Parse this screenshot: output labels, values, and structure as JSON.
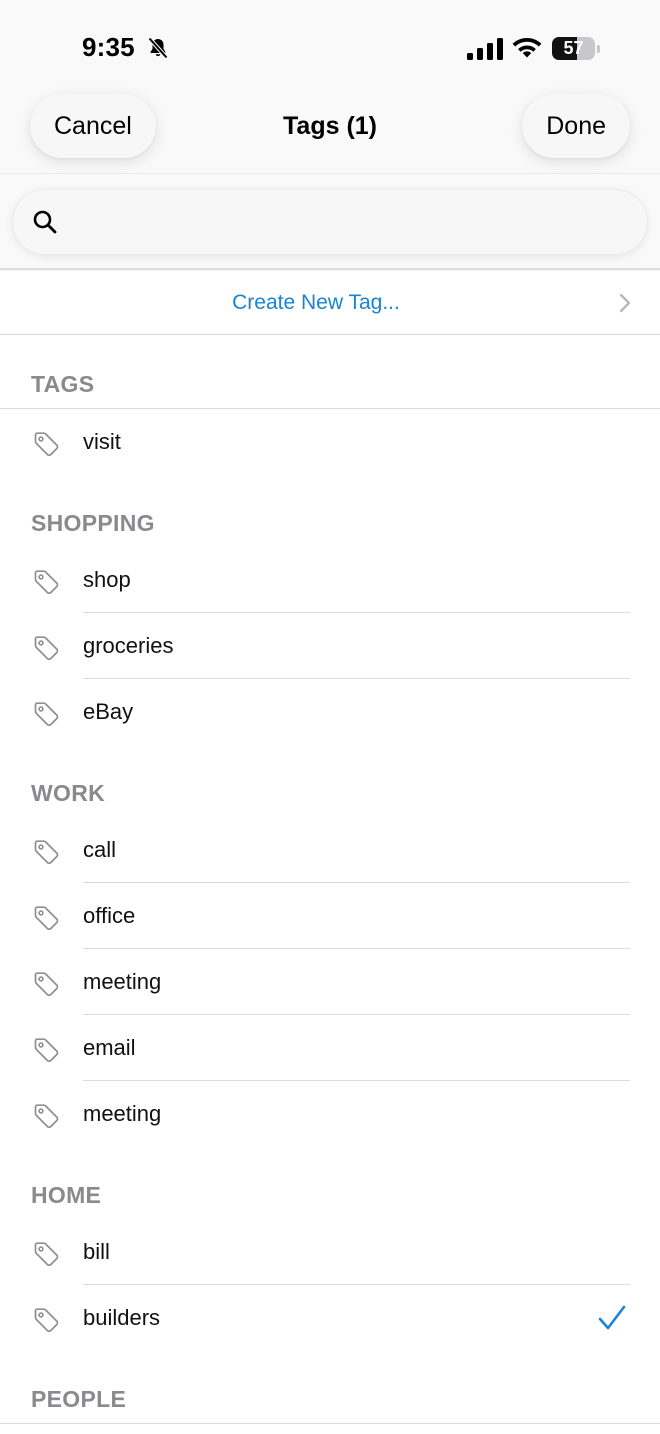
{
  "status_bar": {
    "time": "9:35",
    "battery": "57",
    "battery_level": 0.57
  },
  "nav": {
    "cancel_label": "Cancel",
    "title": "Tags (1)",
    "done_label": "Done"
  },
  "search": {
    "value": "",
    "placeholder": ""
  },
  "create_row": {
    "label": "Create New Tag..."
  },
  "colors": {
    "accent": "#1a84d8",
    "section_header": "#8a8a8e",
    "background": "#f9f9f9"
  },
  "sections": [
    {
      "header": "TAGS",
      "items": [
        {
          "label": "visit",
          "selected": false
        }
      ]
    },
    {
      "header": "SHOPPING",
      "items": [
        {
          "label": "shop",
          "selected": false
        },
        {
          "label": "groceries",
          "selected": false
        },
        {
          "label": "eBay",
          "selected": false
        }
      ]
    },
    {
      "header": "WORK",
      "items": [
        {
          "label": "call",
          "selected": false
        },
        {
          "label": "office",
          "selected": false
        },
        {
          "label": "meeting",
          "selected": false
        },
        {
          "label": "email",
          "selected": false
        },
        {
          "label": "meeting",
          "selected": false
        }
      ]
    },
    {
      "header": "HOME",
      "items": [
        {
          "label": "bill",
          "selected": false
        },
        {
          "label": "builders",
          "selected": true
        }
      ]
    },
    {
      "header": "PEOPLE",
      "items": []
    }
  ]
}
